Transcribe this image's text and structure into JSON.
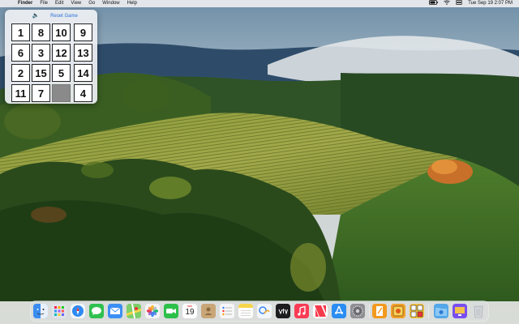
{
  "menubar": {
    "apple_glyph": "",
    "app_name": "Finder",
    "menus": [
      "File",
      "Edit",
      "View",
      "Go",
      "Window",
      "Help"
    ],
    "clock": "Tue Sep 19  2:07 PM",
    "status_icons": [
      "battery-icon",
      "wifi-icon",
      "control-center-icon"
    ]
  },
  "game": {
    "sound_glyph": "🔈",
    "reset_label": "Reset Game",
    "tiles": [
      [
        "1",
        "8",
        "10",
        "9"
      ],
      [
        "6",
        "3",
        "12",
        "13"
      ],
      [
        "2",
        "15",
        "5",
        "14"
      ],
      [
        "11",
        "7",
        "",
        "4"
      ]
    ]
  },
  "dock": {
    "calendar": {
      "month": "SEP",
      "day": "19"
    },
    "items": [
      {
        "name": "finder-icon",
        "color": "#3b8df0"
      },
      {
        "name": "launchpad-icon",
        "color": "#dfe3ea"
      },
      {
        "name": "safari-icon",
        "color": "#2e8af2"
      },
      {
        "name": "messages-icon",
        "color": "#2fc14f"
      },
      {
        "name": "mail-icon",
        "color": "#3c8ff4"
      },
      {
        "name": "maps-icon",
        "color": "#7ccf6a"
      },
      {
        "name": "photos-icon",
        "color": "#f4f4f4"
      },
      {
        "name": "facetime-icon",
        "color": "#2cc04a"
      },
      {
        "name": "calendar-icon",
        "color": "#ffffff"
      },
      {
        "name": "contacts-icon",
        "color": "#c9a678"
      },
      {
        "name": "reminders-icon",
        "color": "#f7f7f7"
      },
      {
        "name": "notes-icon",
        "color": "#f7e27a"
      },
      {
        "name": "freeform-icon",
        "color": "#f2f6fa"
      },
      {
        "name": "tv-icon",
        "color": "#1c1c1e"
      },
      {
        "name": "music-icon",
        "color": "#fa3b55"
      },
      {
        "name": "news-icon",
        "color": "#f53a4c"
      },
      {
        "name": "app-store-icon",
        "color": "#2b8df2"
      },
      {
        "name": "system-settings-icon",
        "color": "#8e8e93"
      },
      {
        "name": "pages-icon",
        "color": "#f29a1f"
      },
      {
        "name": "game-app-icon",
        "color": "#f0a22a"
      },
      {
        "name": "puzzle-15-icon",
        "color": "#f6c23a"
      },
      {
        "name": "downloads-folder-icon",
        "color": "#54a7e8"
      },
      {
        "name": "screen-capture-icon",
        "color": "#7a4df0"
      },
      {
        "name": "trash-icon",
        "color": "#cfd2d6"
      }
    ]
  }
}
